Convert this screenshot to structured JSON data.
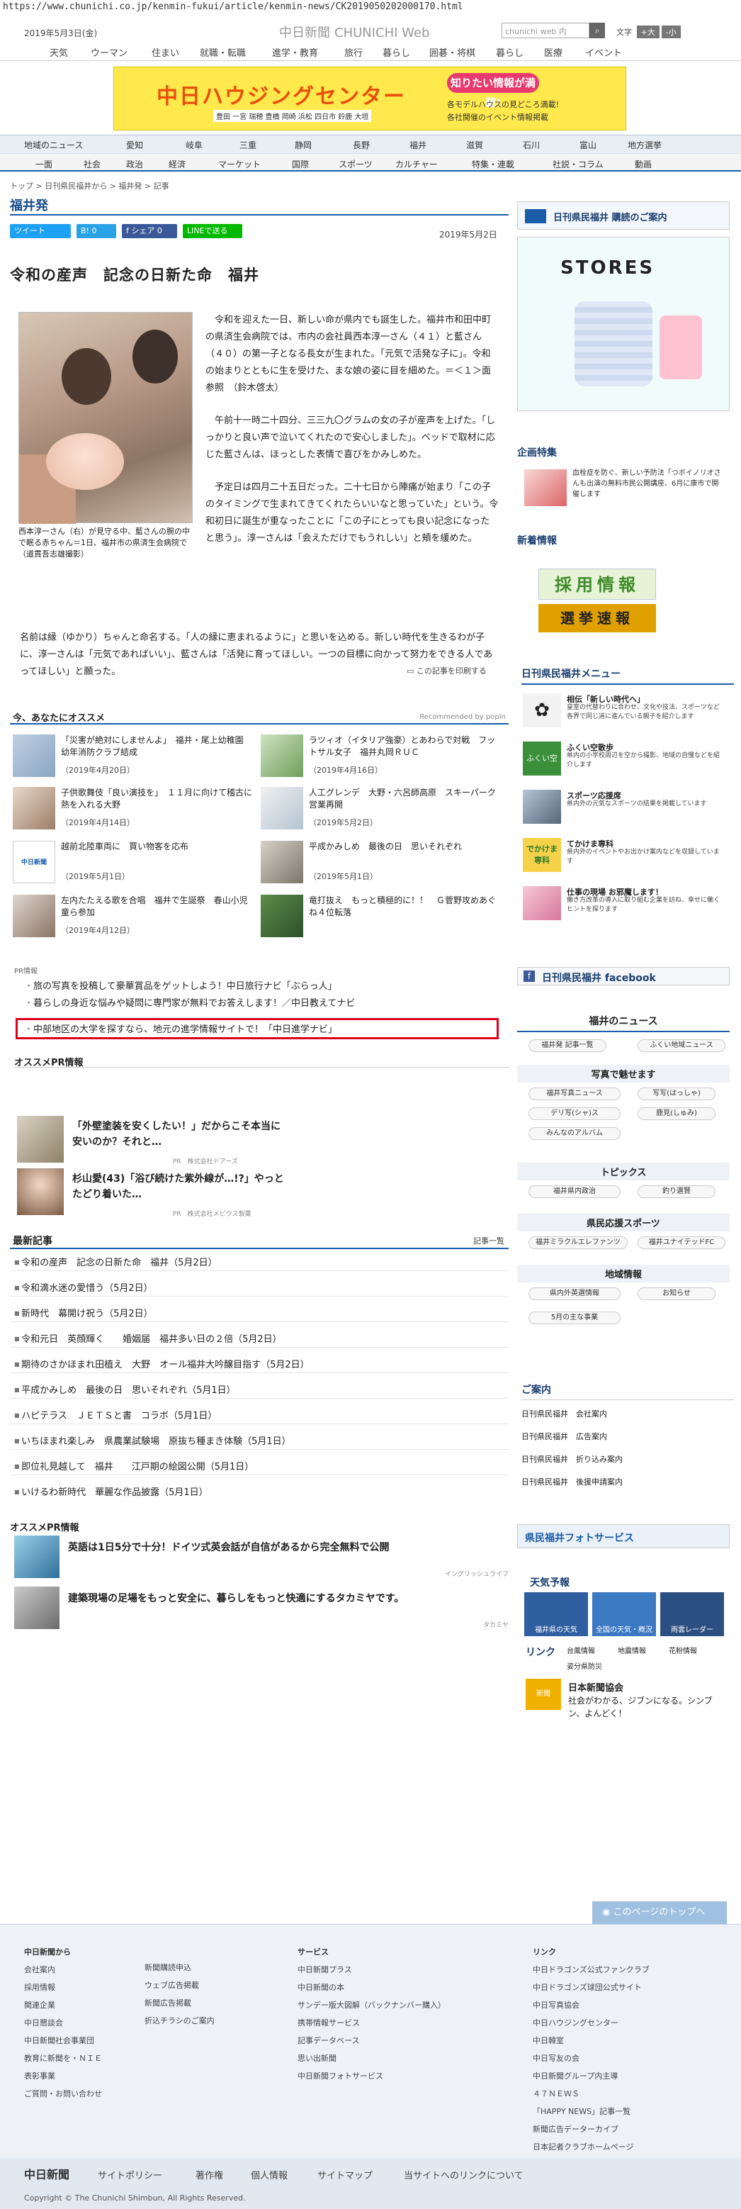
{
  "url": "https://www.chunichi.co.jp/kenmin-fukui/article/kenmin-news/CK2019050202000170.html",
  "header": {
    "date": "2019年5月3日(金)",
    "logo": "中日新聞",
    "logo_sub": "CHUNICHI Web",
    "search_placeholder": "chunichi web 内",
    "font_label": "文字",
    "font_big": "+大",
    "font_small": "-小"
  },
  "nav1": [
    "天気",
    "ウーマン",
    "住まい",
    "就職・転職",
    "進学・教育",
    "旅行",
    "暮らし",
    "囲碁・将棋",
    "暮らし",
    "医療",
    "イベント"
  ],
  "banner": {
    "title": "中日ハウジングセンター",
    "badge": "知りたい情報が満載!",
    "l1": "各モデルハウスの見どころ満載!",
    "l2": "各社開催のイベント情報掲載",
    "loc": "豊田 一宮 瑞穂 豊橋 岡崎 浜松 四日市 鈴鹿 大垣"
  },
  "nav2": [
    "地域のニュース",
    "愛知",
    "岐阜",
    "三重",
    "静岡",
    "長野",
    "福井",
    "滋賀",
    "石川",
    "富山",
    "地方選挙"
  ],
  "nav3": [
    "一面",
    "社会",
    "政治",
    "経済",
    "マーケット",
    "国際",
    "スポーツ",
    "カルチャー",
    "特集・連載",
    "社説・コラム",
    "動画"
  ],
  "breadcrumb": "トップ > 日刊県民福井から > 福井発 > 記事",
  "page_title": "福井発",
  "social": {
    "tweet": "ツイート",
    "b": "B! 0",
    "share": "f シェア 0",
    "line": "LINEで送る"
  },
  "pub_date": "2019年5月2日",
  "article": {
    "title": "令和の産声　記念の日新た命　福井",
    "caption": "西本淳一さん（右）が見守る中、藍さんの腕の中で眠る赤ちゃん＝1日、福井市の県済生会病院で（道貫吾志雄撮影）",
    "p1": "令和を迎えた一日、新しい命が県内でも誕生した。福井市和田中町の県済生会病院では、市内の会社員西本淳一さん（４１）と藍さん（４０）の第一子となる長女が生まれた。「元気で活発な子に」。令和の始まりとともに生を受けた、まな娘の姿に目を細めた。＝＜１＞面参照　（鈴木啓太）",
    "p2": "午前十一時二十四分、三三九〇グラムの女の子が産声を上げた。「しっかりと良い声で泣いてくれたので安心しました」。ベッドで取材に応じた藍さんは、ほっとした表情で喜びをかみしめた。",
    "p3": "予定日は四月二十五日だった。二十七日から陣痛が始まり「この子のタイミングで生まれてきてくれたらいいなと思っていた」という。令和初日に誕生が重なったことに「この子にとっても良い記念になったと思う」。淳一さんは「会えただけでもうれしい」と頬を緩めた。",
    "p4": "名前は縁（ゆかり）ちゃんと命名する。「人の縁に恵まれるように」と思いを込める。新しい時代を生きるわが子に、淳一さんは「元気であればいい」、藍さんは「活発に育ってほしい。一つの目標に向かって努力をできる人であってほしい」と願った。",
    "print": "この記事を印刷する"
  },
  "recommend": {
    "heading": "今、あなたにオススメ",
    "powered": "Recommended by popIn",
    "items": [
      {
        "title": "「災害が絶対にしませんよ」　福井・尾上幼稚園　幼年消防クラブ結成",
        "date": "（2019年4月20日）"
      },
      {
        "title": "ラツィオ（イタリア強豪）とあわらで対戦　フットサル女子　福井丸岡ＲＵＣ",
        "date": "（2019年4月16日）"
      },
      {
        "title": "子供歌舞伎「良い演技を」　１１月に向けて稽古に熱を入れる大野",
        "date": "（2019年4月14日）"
      },
      {
        "title": "人工グレンデ　大野・六呂師高原　スキーパーク営業再開",
        "date": "（2019年5月2日）"
      },
      {
        "title": "越前北陸車両に　買い物客を応布",
        "date": "（2019年5月1日）"
      },
      {
        "title": "平成かみしめ　最後の日　思いそれぞれ",
        "date": "（2019年5月1日）"
      },
      {
        "title": "左内たたえる歌を合唱　福井で生誕祭　春山小児童ら参加",
        "date": "（2019年4月12日）"
      },
      {
        "title": "竜打抜え　もっと積極的に！！　Ｇ菅野攻めあぐね４位転落",
        "date": ""
      }
    ]
  },
  "pr": {
    "label": "PR情報",
    "items": [
      "旅の写真を投稿して豪華賞品をゲットしよう！中日旅行ナビ「ぶらっ人」",
      "暮らしの身近な悩みや疑問に専門家が無料でお答えします！／中日教えてナビ",
      "中部地区の大学を探すなら、地元の進学情報サイトで！「中日進学ナビ」"
    ]
  },
  "osusume": {
    "heading": "オススメPR情報",
    "items": [
      {
        "title": "「外壁塗装を安くしたい！」だからこそ本当に安いのか？それと…",
        "src": "PR　株式会社ドアーズ"
      },
      {
        "title": "杉山愛(43)「浴び続けた紫外線が…!?」やっとたどり着いた…",
        "src": "PR　株式会社メビウス製薬"
      }
    ]
  },
  "latest": {
    "heading": "最新記事",
    "more": "記事一覧",
    "items": [
      "令和の産声　記念の日新た命　福井（5月2日）",
      "令和滴水迷の愛惜う（5月2日）",
      "新時代　幕開け祝う（5月2日）",
      "令和元日　英顔輝く　　婚姻届　福井多い日の２倍（5月2日）",
      "期待のさかほまれ田植え　大野　オール福井大吟醸目指す（5月2日）",
      "平成かみしめ　最後の日　思いそれぞれ（5月1日）",
      "ハピテラス　ＪＥＴＳと書　コラボ（5月1日）",
      "いちほまれ楽しみ　県農業試験場　原抜ち種まき体験（5月1日）",
      "即位礼見越して　福井　　江戸期の絵図公開（5月1日）",
      "いけるわ新時代　華麗な作品披露（5月1日）"
    ]
  },
  "pr2": {
    "heading": "オススメPR情報",
    "items": [
      {
        "title": "英語は1日5分で十分！ドイツ式英会話が自信があるから完全無料で公開",
        "src": "イングリッシュライフ"
      },
      {
        "title": "建築現場の足場をもっと安全に、暮らしをもっと快適にするタカミヤです。",
        "src": "タカミヤ"
      }
    ]
  },
  "side": {
    "kounyu": "日刊県民福井 購読のご案内",
    "stores": "STORES",
    "kikaku": "企画特集",
    "kikaku_text": "血栓症を防ぐ、新しい予防法「つボイノリオさんも出演の無料市民公開講座、6月に康市で開催します",
    "shinchaku": "新着情報",
    "saiyou": "採用情報",
    "senkyo": "選挙速報",
    "menu_heading": "日刊県民福井メニュー",
    "menu": [
      {
        "t": "相伝「新しい時代へ」",
        "d": "皇室の代替わりに合わせ、文化や技法、スポーツなど各界で同じ道に進んでいる親子を紹介します"
      },
      {
        "t": "ふくい空散歩",
        "d": "県内の小学校周辺を空から撮影、地域の自慢などを紹介します"
      },
      {
        "t": "スポーツ応援席",
        "d": "県内外の元気なスポーツの結果を掲載しています"
      },
      {
        "t": "てかけま専科",
        "d": "県内外のイベントやお出かけ案内などを収録しています"
      },
      {
        "t": "仕事の現場 お邪魔します！",
        "d": "働き方改革の導入に取り組む企業を訪ね、幸せに働くヒントを探ります"
      }
    ],
    "facebook": "日刊県民福井 facebook",
    "fukui_news": "福井のニュース",
    "fn_items": [
      "福井発 記事一覧",
      "ふくい地域ニュース"
    ],
    "photo_heading": "写真で魅せます",
    "photo_items": [
      "福井写真ニュース",
      "写写(はっしゃ)",
      "デリ写(シャ)ス",
      "鹿見(しゅみ)",
      "みんなのアルバム"
    ],
    "topics": "トピックス",
    "topics_items": [
      "福井県内政治",
      "釣り選賢"
    ],
    "sports": "県民応援スポーツ",
    "sports_items": [
      "福井ミラクルエレファンツ",
      "福井ユナイテッドFC"
    ],
    "chiiki": "地域情報",
    "chiiki_items": [
      "県内外英選情報",
      "お知らせ",
      "5月の主な事業"
    ],
    "annai": "ご案内",
    "annai_items": [
      "日刊県民福井　会社案内",
      "日刊県民福井　広告案内",
      "日刊県民福井　折り込み案内",
      "日刊県民福井　後援申請案内"
    ],
    "photo_service": "県民福井フォトサービス",
    "tenki": "天気予報",
    "tenki_items": [
      "福井県の天気",
      "全国の天気・概況",
      "雨雲レーダー"
    ],
    "link": "リンク",
    "link_items": [
      "台風情報",
      "地震情報",
      "花粉情報",
      "姿分県防災"
    ],
    "jpa": "日本新聞協会",
    "jpa_text": "社会がわかる、ジブンになる。シンブン、よんどく！"
  },
  "footer": {
    "to_top": "このページのトップへ",
    "c1_head": "中日新聞から",
    "c1": [
      "会社案内",
      "採用情報",
      "関連企業",
      "中日懇談会",
      "中日新聞社会事業団",
      "教育に新聞を・ＮＩＥ",
      "表彰事業",
      "ご質問・お問い合わせ"
    ],
    "c2": [
      "新聞購読申込",
      "ウェブ広告掲載",
      "新聞広告掲載",
      "折込チラシのご案内"
    ],
    "c3_head": "サービス",
    "c3": [
      "中日新聞プラス",
      "中日新聞の本",
      "サンデー版大図解（バックナンバー購入）",
      "携帯情報サービス",
      "記事データベース",
      "思い出新聞",
      "中日新聞フォトサービス"
    ],
    "c4_head": "リンク",
    "c4": [
      "中日ドラゴンズ公式ファンクラブ",
      "中日ドラゴンズ球団公式サイト",
      "中日写真協会",
      "中日ハウジングセンター",
      "中日韓室",
      "中日写友の会",
      "中日新聞グループ内主導",
      "４７ＮＥＷＳ",
      "「HAPPY NEWS」記事一覧",
      "新聞広告データーカイブ",
      "日本記者クラブホームページ"
    ],
    "bottom_logo": "中日新聞",
    "bottom": [
      "サイトポリシー",
      "著作権",
      "個人情報",
      "サイトマップ",
      "当サイトへのリンクについて"
    ],
    "copyright": "Copyright © The Chunichi Shimbun, All Rights Reserved."
  }
}
